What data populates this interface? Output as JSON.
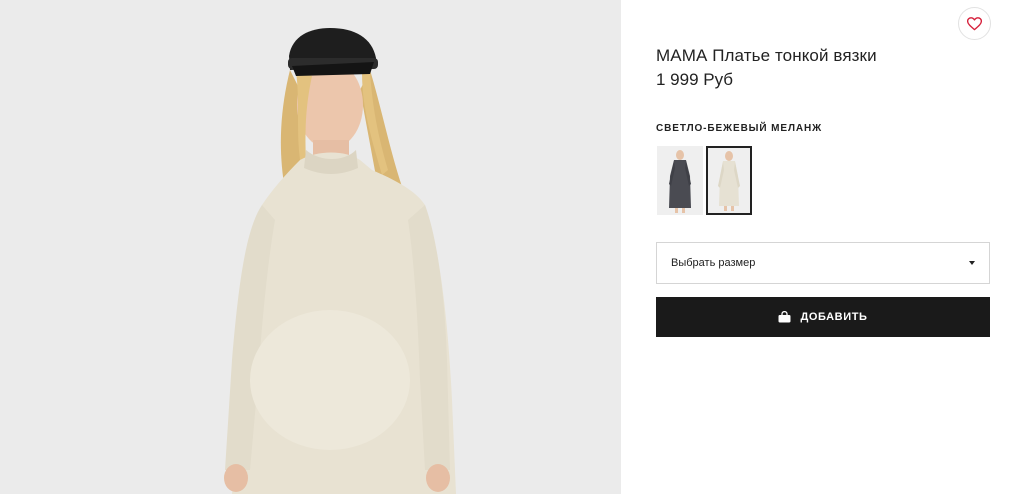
{
  "product": {
    "title": "МАМА Платье тонкой вязки",
    "price": "1 999 Руб",
    "color_name": "СВЕТЛО-БЕЖЕВЫЙ МЕЛАНЖ"
  },
  "swatches": [
    {
      "name": "dark-grey",
      "color": "#4a4b52",
      "selected": false
    },
    {
      "name": "light-beige-melange",
      "color": "#e6e1d3",
      "selected": true
    }
  ],
  "size_select": {
    "placeholder": "Выбрать размер"
  },
  "add_button": {
    "label": "ДОБАВИТЬ"
  },
  "icons": {
    "favorite": "heart-icon",
    "bag": "shopping-bag-icon",
    "dropdown": "caret-down-icon"
  },
  "colors": {
    "heart": "#d6213c",
    "button_bg": "#1a1a1a",
    "photo_bg": "#ebebeb"
  }
}
